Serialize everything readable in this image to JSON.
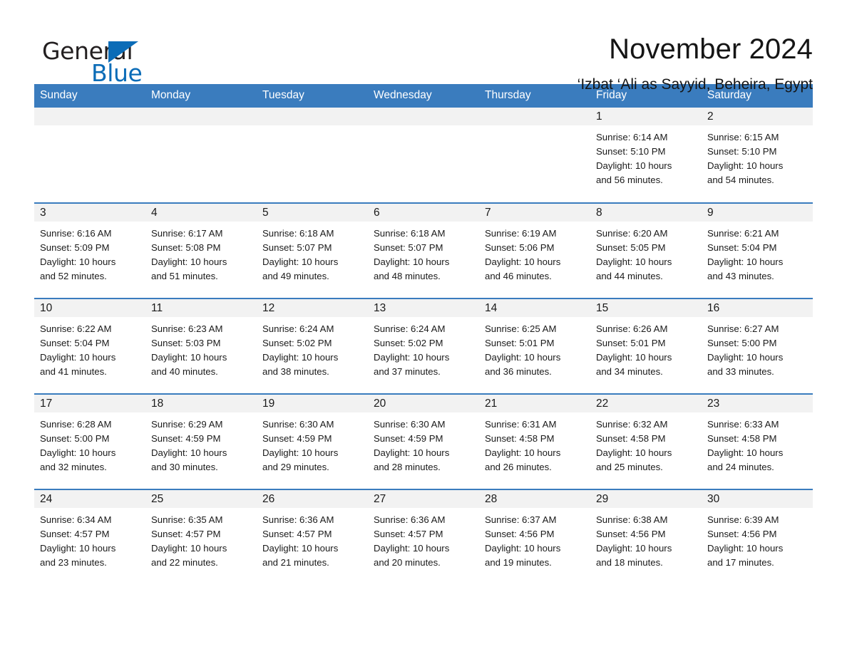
{
  "logo": {
    "word_one": "General",
    "word_two": "Blue",
    "triangle_icon": "blue-triangle-icon",
    "brand_color": "#0b6cb7"
  },
  "header": {
    "title": "November 2024",
    "location": "‘Izbat ‘Ali as Sayyid, Beheira, Egypt"
  },
  "calendar": {
    "header_bg": "#3a7cbe",
    "daynum_bg": "#f2f2f2",
    "weekday_headers": [
      "Sunday",
      "Monday",
      "Tuesday",
      "Wednesday",
      "Thursday",
      "Friday",
      "Saturday"
    ],
    "weeks": [
      [
        {
          "day": "",
          "lines": []
        },
        {
          "day": "",
          "lines": []
        },
        {
          "day": "",
          "lines": []
        },
        {
          "day": "",
          "lines": []
        },
        {
          "day": "",
          "lines": []
        },
        {
          "day": "1",
          "lines": [
            "Sunrise: 6:14 AM",
            "Sunset: 5:10 PM",
            "Daylight: 10 hours",
            "and 56 minutes."
          ]
        },
        {
          "day": "2",
          "lines": [
            "Sunrise: 6:15 AM",
            "Sunset: 5:10 PM",
            "Daylight: 10 hours",
            "and 54 minutes."
          ]
        }
      ],
      [
        {
          "day": "3",
          "lines": [
            "Sunrise: 6:16 AM",
            "Sunset: 5:09 PM",
            "Daylight: 10 hours",
            "and 52 minutes."
          ]
        },
        {
          "day": "4",
          "lines": [
            "Sunrise: 6:17 AM",
            "Sunset: 5:08 PM",
            "Daylight: 10 hours",
            "and 51 minutes."
          ]
        },
        {
          "day": "5",
          "lines": [
            "Sunrise: 6:18 AM",
            "Sunset: 5:07 PM",
            "Daylight: 10 hours",
            "and 49 minutes."
          ]
        },
        {
          "day": "6",
          "lines": [
            "Sunrise: 6:18 AM",
            "Sunset: 5:07 PM",
            "Daylight: 10 hours",
            "and 48 minutes."
          ]
        },
        {
          "day": "7",
          "lines": [
            "Sunrise: 6:19 AM",
            "Sunset: 5:06 PM",
            "Daylight: 10 hours",
            "and 46 minutes."
          ]
        },
        {
          "day": "8",
          "lines": [
            "Sunrise: 6:20 AM",
            "Sunset: 5:05 PM",
            "Daylight: 10 hours",
            "and 44 minutes."
          ]
        },
        {
          "day": "9",
          "lines": [
            "Sunrise: 6:21 AM",
            "Sunset: 5:04 PM",
            "Daylight: 10 hours",
            "and 43 minutes."
          ]
        }
      ],
      [
        {
          "day": "10",
          "lines": [
            "Sunrise: 6:22 AM",
            "Sunset: 5:04 PM",
            "Daylight: 10 hours",
            "and 41 minutes."
          ]
        },
        {
          "day": "11",
          "lines": [
            "Sunrise: 6:23 AM",
            "Sunset: 5:03 PM",
            "Daylight: 10 hours",
            "and 40 minutes."
          ]
        },
        {
          "day": "12",
          "lines": [
            "Sunrise: 6:24 AM",
            "Sunset: 5:02 PM",
            "Daylight: 10 hours",
            "and 38 minutes."
          ]
        },
        {
          "day": "13",
          "lines": [
            "Sunrise: 6:24 AM",
            "Sunset: 5:02 PM",
            "Daylight: 10 hours",
            "and 37 minutes."
          ]
        },
        {
          "day": "14",
          "lines": [
            "Sunrise: 6:25 AM",
            "Sunset: 5:01 PM",
            "Daylight: 10 hours",
            "and 36 minutes."
          ]
        },
        {
          "day": "15",
          "lines": [
            "Sunrise: 6:26 AM",
            "Sunset: 5:01 PM",
            "Daylight: 10 hours",
            "and 34 minutes."
          ]
        },
        {
          "day": "16",
          "lines": [
            "Sunrise: 6:27 AM",
            "Sunset: 5:00 PM",
            "Daylight: 10 hours",
            "and 33 minutes."
          ]
        }
      ],
      [
        {
          "day": "17",
          "lines": [
            "Sunrise: 6:28 AM",
            "Sunset: 5:00 PM",
            "Daylight: 10 hours",
            "and 32 minutes."
          ]
        },
        {
          "day": "18",
          "lines": [
            "Sunrise: 6:29 AM",
            "Sunset: 4:59 PM",
            "Daylight: 10 hours",
            "and 30 minutes."
          ]
        },
        {
          "day": "19",
          "lines": [
            "Sunrise: 6:30 AM",
            "Sunset: 4:59 PM",
            "Daylight: 10 hours",
            "and 29 minutes."
          ]
        },
        {
          "day": "20",
          "lines": [
            "Sunrise: 6:30 AM",
            "Sunset: 4:59 PM",
            "Daylight: 10 hours",
            "and 28 minutes."
          ]
        },
        {
          "day": "21",
          "lines": [
            "Sunrise: 6:31 AM",
            "Sunset: 4:58 PM",
            "Daylight: 10 hours",
            "and 26 minutes."
          ]
        },
        {
          "day": "22",
          "lines": [
            "Sunrise: 6:32 AM",
            "Sunset: 4:58 PM",
            "Daylight: 10 hours",
            "and 25 minutes."
          ]
        },
        {
          "day": "23",
          "lines": [
            "Sunrise: 6:33 AM",
            "Sunset: 4:58 PM",
            "Daylight: 10 hours",
            "and 24 minutes."
          ]
        }
      ],
      [
        {
          "day": "24",
          "lines": [
            "Sunrise: 6:34 AM",
            "Sunset: 4:57 PM",
            "Daylight: 10 hours",
            "and 23 minutes."
          ]
        },
        {
          "day": "25",
          "lines": [
            "Sunrise: 6:35 AM",
            "Sunset: 4:57 PM",
            "Daylight: 10 hours",
            "and 22 minutes."
          ]
        },
        {
          "day": "26",
          "lines": [
            "Sunrise: 6:36 AM",
            "Sunset: 4:57 PM",
            "Daylight: 10 hours",
            "and 21 minutes."
          ]
        },
        {
          "day": "27",
          "lines": [
            "Sunrise: 6:36 AM",
            "Sunset: 4:57 PM",
            "Daylight: 10 hours",
            "and 20 minutes."
          ]
        },
        {
          "day": "28",
          "lines": [
            "Sunrise: 6:37 AM",
            "Sunset: 4:56 PM",
            "Daylight: 10 hours",
            "and 19 minutes."
          ]
        },
        {
          "day": "29",
          "lines": [
            "Sunrise: 6:38 AM",
            "Sunset: 4:56 PM",
            "Daylight: 10 hours",
            "and 18 minutes."
          ]
        },
        {
          "day": "30",
          "lines": [
            "Sunrise: 6:39 AM",
            "Sunset: 4:56 PM",
            "Daylight: 10 hours",
            "and 17 minutes."
          ]
        }
      ]
    ]
  }
}
